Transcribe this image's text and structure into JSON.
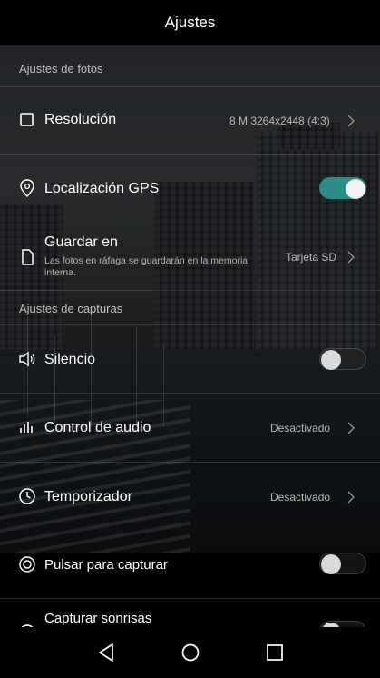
{
  "header": {
    "title": "Ajustes"
  },
  "sections": {
    "photo": "Ajustes de fotos",
    "capture": "Ajustes de capturas"
  },
  "items": {
    "resolution": {
      "label": "Resolución",
      "value": "8 M 3264x2448 (4:3)",
      "icon": "square-icon"
    },
    "gps": {
      "label": "Localización GPS",
      "enabled": true,
      "icon": "location-pin-icon"
    },
    "save": {
      "label": "Guardar en",
      "sub": "Las fotos en ráfaga se guardarán en la memoria interna.",
      "value": "Tarjeta SD",
      "icon": "file-icon"
    },
    "silence": {
      "label": "Silencio",
      "enabled": false,
      "icon": "speaker-icon"
    },
    "audio": {
      "label": "Control de audio",
      "value": "Desactivado",
      "icon": "audio-bars-icon"
    },
    "timer": {
      "label": "Temporizador",
      "value": "Desactivado",
      "icon": "clock-icon"
    },
    "tap": {
      "label": "Pulsar para capturar",
      "enabled": false,
      "icon": "target-icon"
    },
    "smile": {
      "label": "Capturar sonrisas",
      "enabled": false,
      "icon": "smile-icon"
    }
  },
  "navbar": {
    "back": "back-icon",
    "home": "home-icon",
    "recents": "recents-icon"
  },
  "colors": {
    "toggle_on": "#2a8f8a",
    "background": "#000000"
  }
}
